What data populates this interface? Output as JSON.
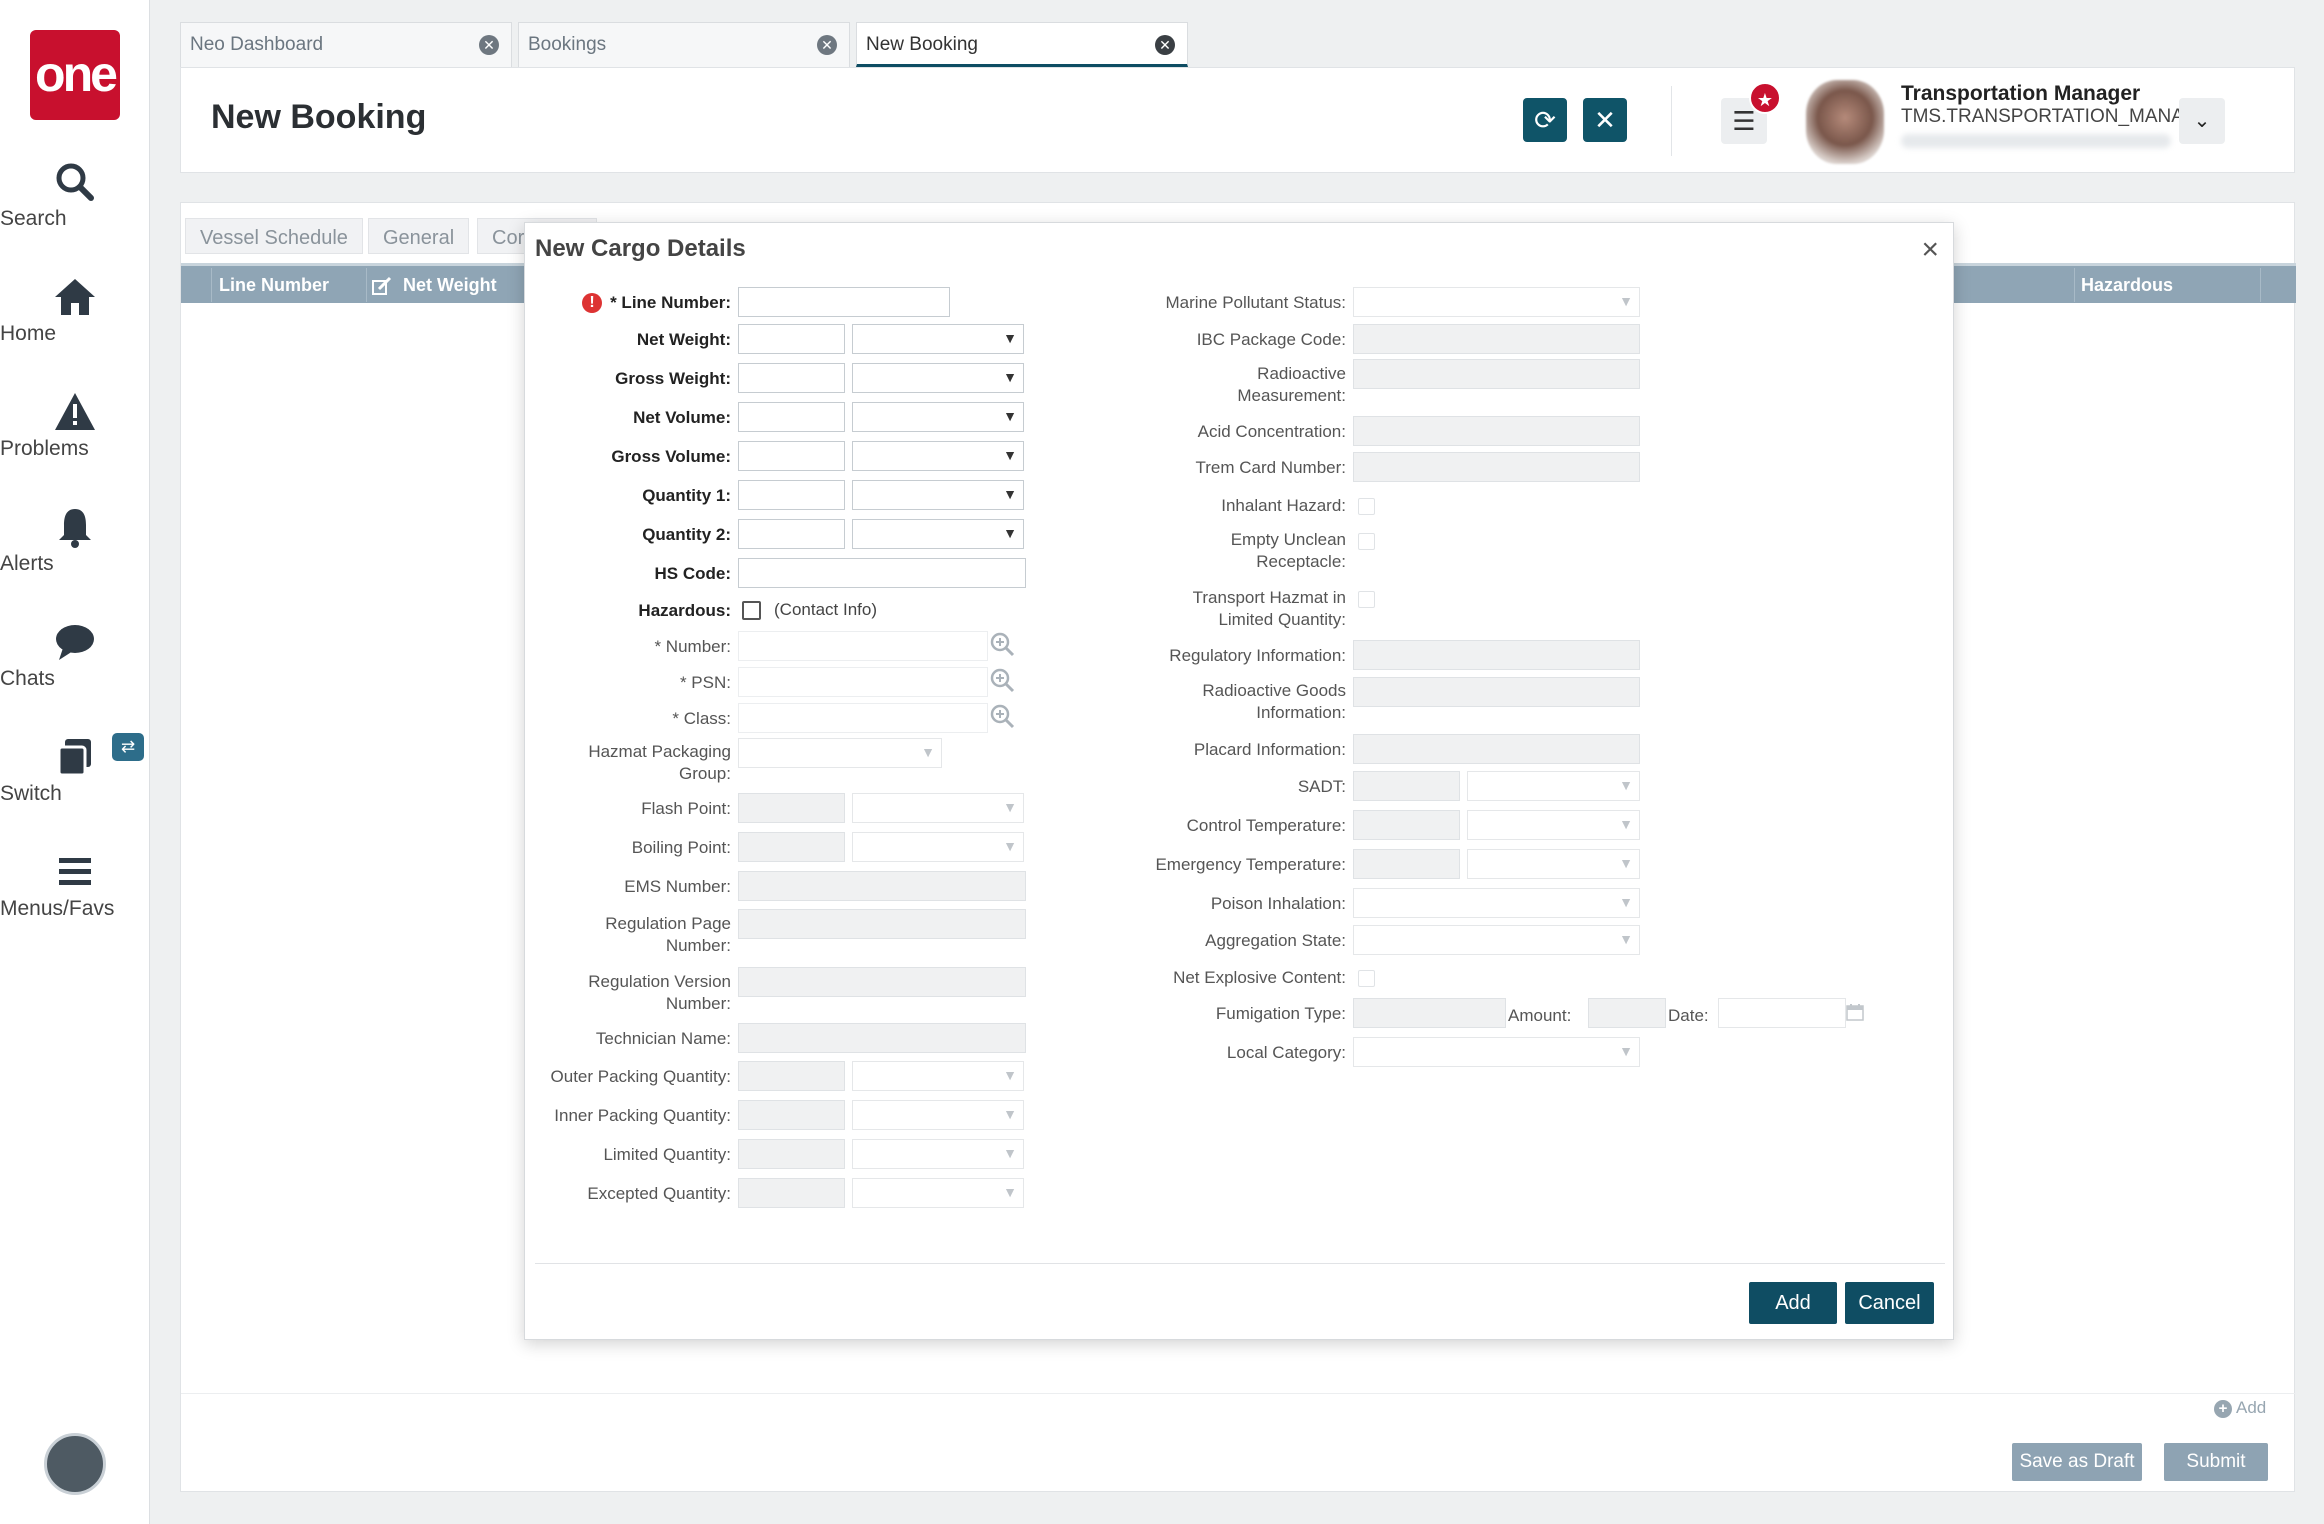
{
  "nav": {
    "logo": "one",
    "items": [
      {
        "label": "Search",
        "icon": "search-icon"
      },
      {
        "label": "Home",
        "icon": "home-icon"
      },
      {
        "label": "Problems",
        "icon": "warning-icon"
      },
      {
        "label": "Alerts",
        "icon": "bell-icon"
      },
      {
        "label": "Chats",
        "icon": "chat-icon"
      },
      {
        "label": "Switch",
        "icon": "switch-icon"
      },
      {
        "label": "Menus/Favs",
        "icon": "menu-icon"
      }
    ]
  },
  "tabs": [
    {
      "label": "Neo Dashboard"
    },
    {
      "label": "Bookings"
    },
    {
      "label": "New Booking"
    }
  ],
  "header": {
    "title": "New Booking",
    "user_name": "Transportation Manager",
    "user_role": "TMS.TRANSPORTATION_MANAGER"
  },
  "subtabs": {
    "vessel": "Vessel Schedule",
    "general": "General",
    "cor": "Cor"
  },
  "grid": {
    "columns": {
      "line_number": "Line Number",
      "net_weight": "Net Weight",
      "hazardous": "Hazardous"
    }
  },
  "panel": {
    "add_label": "Add",
    "save_draft": "Save as Draft",
    "submit": "Submit"
  },
  "modal": {
    "title": "New Cargo Details",
    "left": {
      "line_number": "* Line Number:",
      "net_weight": "Net Weight:",
      "gross_weight": "Gross Weight:",
      "net_volume": "Net Volume:",
      "gross_volume": "Gross Volume:",
      "quantity1": "Quantity 1:",
      "quantity2": "Quantity 2:",
      "hs_code": "HS Code:",
      "hazardous": "Hazardous:",
      "contact_info": "(Contact Info)",
      "number": "* Number:",
      "psn": "* PSN:",
      "class": "* Class:",
      "hazmat_pkg_1": "Hazmat Packaging",
      "hazmat_pkg_2": "Group:",
      "flash_point": "Flash Point:",
      "boiling_point": "Boiling Point:",
      "ems_number": "EMS Number:",
      "reg_page_1": "Regulation Page",
      "reg_page_2": "Number:",
      "reg_version_1": "Regulation Version",
      "reg_version_2": "Number:",
      "technician": "Technician Name:",
      "outer_pkg": "Outer Packing Quantity:",
      "inner_pkg": "Inner Packing Quantity:",
      "limited_qty": "Limited Quantity:",
      "excepted_qty": "Excepted Quantity:"
    },
    "right": {
      "marine_pollutant": "Marine Pollutant Status:",
      "ibc_code": "IBC Package Code:",
      "radio_meas_1": "Radioactive",
      "radio_meas_2": "Measurement:",
      "acid": "Acid Concentration:",
      "trem": "Trem Card Number:",
      "inhalant": "Inhalant Hazard:",
      "empty_unclean_1": "Empty Unclean",
      "empty_unclean_2": "Receptacle:",
      "transport_hazmat_1": "Transport Hazmat in",
      "transport_hazmat_2": "Limited Quantity:",
      "regulatory": "Regulatory Information:",
      "radio_goods_1": "Radioactive Goods",
      "radio_goods_2": "Information:",
      "placard": "Placard Information:",
      "sadt": "SADT:",
      "control_temp": "Control Temperature:",
      "emergency_temp": "Emergency Temperature:",
      "poison": "Poison Inhalation:",
      "aggregation": "Aggregation State:",
      "net_explosive": "Net Explosive Content:",
      "fumigation": "Fumigation Type:",
      "amount": "Amount:",
      "date": "Date:",
      "local_category": "Local Category:"
    },
    "add_button": "Add",
    "cancel_button": "Cancel"
  }
}
